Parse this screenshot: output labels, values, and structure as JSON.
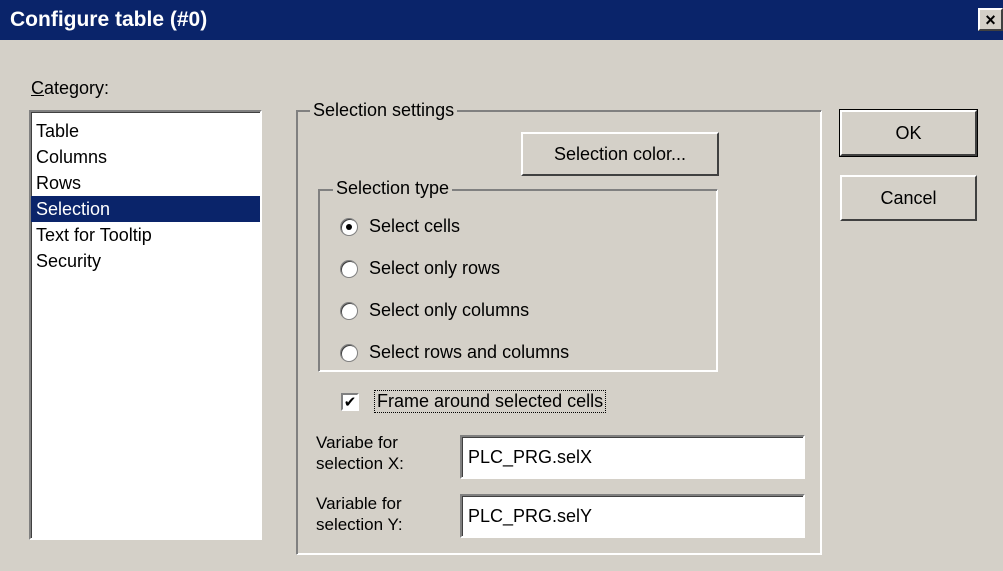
{
  "window": {
    "title": "Configure table (#0)",
    "close_glyph": "×"
  },
  "category": {
    "label": "Category:",
    "items": [
      "Table",
      "Columns",
      "Rows",
      "Selection",
      "Text for Tooltip",
      "Security"
    ],
    "selected_index": 3
  },
  "selection_settings": {
    "group_label": "Selection settings",
    "color_button": "Selection color...",
    "selection_type": {
      "group_label": "Selection type",
      "options": [
        "Select cells",
        "Select only rows",
        "Select only columns",
        "Select rows and columns"
      ],
      "selected_index": 0
    },
    "frame_checkbox": {
      "label": "Frame around selected cells",
      "checked": true,
      "check_glyph": "✔"
    },
    "var_x": {
      "label_line1": "Variabe for",
      "label_line2": "selection X:",
      "value": "PLC_PRG.selX"
    },
    "var_y": {
      "label_line1": "Variable for",
      "label_line2": "selection Y:",
      "value": "PLC_PRG.selY"
    }
  },
  "buttons": {
    "ok": "OK",
    "cancel": "Cancel"
  },
  "colors": {
    "titlebar": "#0a246a",
    "dialog_face": "#d4d0c8",
    "selection_highlight": "#0a246a"
  }
}
